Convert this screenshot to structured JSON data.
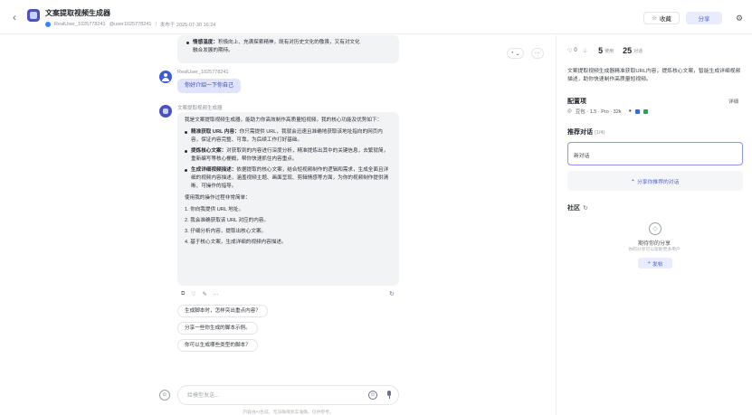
{
  "header": {
    "back_icon": "chevron-left-icon",
    "bot_title": "文案提取视频生成器",
    "author": "RealUser_1025778241",
    "author_id": "@user1025778241",
    "published": "发布于 2025-07-30 16:24",
    "fav_label": "收藏",
    "share_label": "分享"
  },
  "chat": {
    "first_bubble_lines": [
      "情感温度：积极向上、充满探索精神，既有对历史文化的敬畏，又有对",
      "未来发展的期待。"
    ],
    "first_bubble_bold": "情感温度：",
    "first_bubble_rest_1": "积极向上、充满探索精神，既有对历史文化的敬畏，又有对文化",
    "first_bubble_rest_2": "融合发展的期待。",
    "user_name": "RealUser_1025778241",
    "user_message": "你好介绍一下你自己",
    "bot_name": "文案提取视频生成器",
    "intro": "我是文案提取视频生成器，能助力你高效制作高质量短视频。我的核心功能及优势如下：",
    "features": [
      {
        "bold": "精准获取 URL 内容：",
        "text": "你只需提供 URL，我就会迅速且准确地获取该地址指向的网页内容，保证内容完整、可靠，为后续工作打好基础。"
      },
      {
        "bold": "提炼核心文案：",
        "text": "对获取到的内容进行深度分析，精准提炼出其中的关键信息，去繁就简，重新编写等核心梗概，帮你快速抓住内容重点。"
      },
      {
        "bold": "生成详细视频描述：",
        "text": "依据提取的核心文案，结合短视频制作的逻辑和需求，生成全面且详细的视频内容描述，涵盖视频主题、画面呈现、剪辑情感等方面，为你的视频制作提供清晰、可操作的指导。"
      }
    ],
    "usage_intro": "使用我的操作过程非常简单：",
    "steps": [
      "1. 你向我提供 URL 地址。",
      "2. 我会准确获取该 URL 对应的内容。",
      "3. 仔细分析内容，提取出核心文案。",
      "4. 基于核心文案，生成详细的视频内容描述。"
    ],
    "actions": [
      "⧉",
      "♡",
      "✎",
      "···"
    ],
    "suggestions": [
      "生成脚本时，怎样突出重点内容？",
      "分享一些你生成的脚本示例。",
      "你可以生成哪些类型的脚本？"
    ],
    "input_placeholder": "给模型发送...",
    "footer_note": "内容由AI生成，无法确保真实准确，仅供参考。",
    "top_tool_label": "⊙ ⌄",
    "more_label": "···"
  },
  "panel": {
    "likes": "0",
    "dislike_icon": "thumbs-down-icon",
    "users_num": "5",
    "users_label": "使用",
    "chats_num": "25",
    "chats_label": "对话",
    "description": "文案提取视频生成器精准获取URL内容，提炼核心文案，智能生成详细视频描述，助你快速制作高质量短视频。",
    "config_title": "配置项",
    "config_detail": "详细",
    "config_model": "豆包 · 1.5 · Pro · 32k",
    "recommend_title": "推荐对话",
    "recommend_count": "(1/4)",
    "recommend_item": "新对话",
    "recommend_add": "分享你推荐的对话",
    "community_title": "社区",
    "empty_title": "期待你的分享",
    "empty_sub": "你的分享可以帮助更多用户",
    "publish_label": "发帖"
  },
  "colors": {
    "accent": "#4e5fd6",
    "user_bubble": "#dfe3fb",
    "bot_bubble": "#f2f3f5"
  }
}
